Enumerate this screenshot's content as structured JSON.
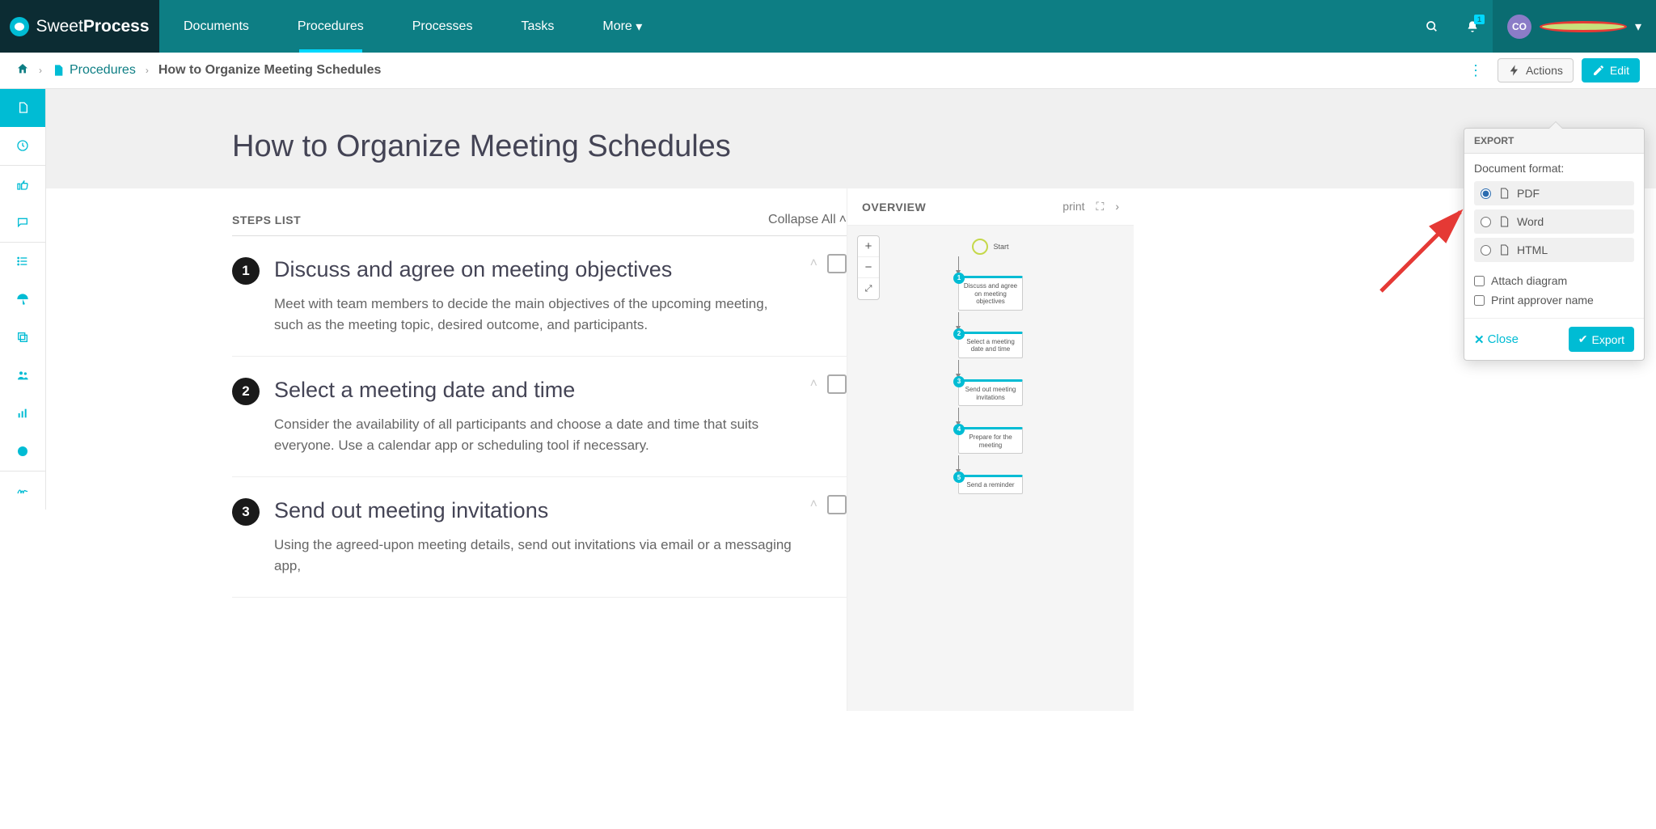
{
  "brand": {
    "name_a": "Sweet",
    "name_b": "Process"
  },
  "nav": {
    "documents": "Documents",
    "procedures": "Procedures",
    "processes": "Processes",
    "tasks": "Tasks",
    "more": "More",
    "notif_count": "1",
    "user_initials": "CO"
  },
  "breadcrumb": {
    "procedures": "Procedures",
    "current": "How to Organize Meeting Schedules",
    "actions": "Actions",
    "edit": "Edit"
  },
  "hero": {
    "title": "How to Organize Meeting Schedules",
    "start": "Start"
  },
  "steps_header": {
    "label": "STEPS LIST",
    "collapse": "Collapse All"
  },
  "steps": [
    {
      "n": "1",
      "title": "Discuss and agree on meeting objectives",
      "desc": "Meet with team members to decide the main objectives of the upcoming meeting, such as the meeting topic, desired outcome, and participants."
    },
    {
      "n": "2",
      "title": "Select a meeting date and time",
      "desc": "Consider the availability of all participants and choose a date and time that suits everyone. Use a calendar app or scheduling tool if necessary."
    },
    {
      "n": "3",
      "title": "Send out meeting invitations",
      "desc": "Using the agreed-upon meeting details, send out invitations via email or a messaging app,"
    }
  ],
  "overview": {
    "label": "OVERVIEW",
    "print": "print",
    "flow_start": "Start",
    "nodes": [
      {
        "n": "1",
        "t": "Discuss and agree on meeting objectives"
      },
      {
        "n": "2",
        "t": "Select a meeting date and time"
      },
      {
        "n": "3",
        "t": "Send out meeting invitations"
      },
      {
        "n": "4",
        "t": "Prepare for the meeting"
      },
      {
        "n": "5",
        "t": "Send a reminder"
      }
    ]
  },
  "export": {
    "title": "EXPORT",
    "format_label": "Document format:",
    "pdf": "PDF",
    "word": "Word",
    "html": "HTML",
    "attach": "Attach diagram",
    "approver": "Print approver name",
    "close": "Close",
    "export_btn": "Export"
  }
}
